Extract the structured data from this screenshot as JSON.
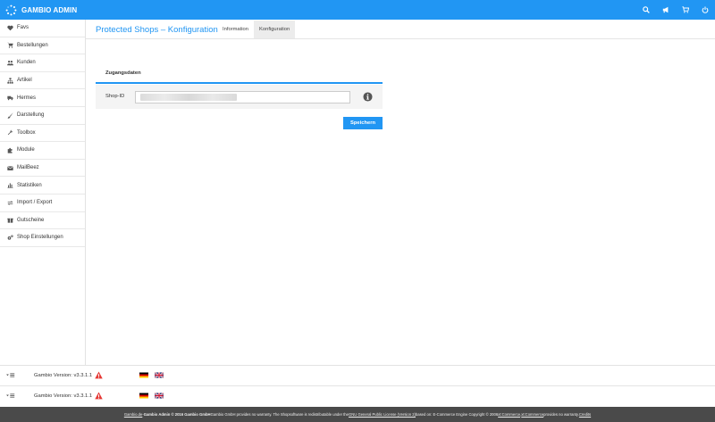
{
  "app": {
    "title": "GAMBIO ADMIN"
  },
  "topbar": {
    "icons": [
      "search-icon",
      "megaphone-icon",
      "cart-icon",
      "power-icon"
    ]
  },
  "sidebar": {
    "items": [
      {
        "label": "Favs",
        "icon": "heart-icon"
      },
      {
        "label": "Bestellungen",
        "icon": "cart-icon"
      },
      {
        "label": "Kunden",
        "icon": "users-icon"
      },
      {
        "label": "Artikel",
        "icon": "sitemap-icon"
      },
      {
        "label": "Hermes",
        "icon": "truck-icon"
      },
      {
        "label": "Darstellung",
        "icon": "brush-icon"
      },
      {
        "label": "Toolbox",
        "icon": "wrench-icon"
      },
      {
        "label": "Module",
        "icon": "puzzle-icon"
      },
      {
        "label": "MailBeez",
        "icon": "envelope-icon"
      },
      {
        "label": "Statistiken",
        "icon": "bar-chart-icon"
      },
      {
        "label": "Import / Export",
        "icon": "exchange-icon"
      },
      {
        "label": "Gutscheine",
        "icon": "gift-icon"
      },
      {
        "label": "Shop Einstellungen",
        "icon": "gears-icon"
      }
    ]
  },
  "page": {
    "title": "Protected Shops – Konfiguration",
    "tabs": [
      {
        "label": "Information",
        "active": false
      },
      {
        "label": "Konfiguration",
        "active": true
      }
    ]
  },
  "panel": {
    "heading": "Zugangsdaten",
    "field_label": "Shop-ID",
    "field_value": "",
    "save_label": "Speichern"
  },
  "footer_rows": [
    {
      "version": "Gambio Version: v3.3.1.1"
    },
    {
      "version": "Gambio Version: v3.3.1.1"
    }
  ],
  "bottombar": {
    "link1": "Gambio.de",
    "part1": " - ",
    "bold1": "Gambio Admin © 2016 Gambio GmbH",
    "part2": " Gambio GmbH provides no warranty. The Shopsoftware is redistributable under the ",
    "link2": "GNU General Public License (Version 2)",
    "part3": " based on: E-Commerce Engine Copyright © 2006 ",
    "link3": "xt:Commerce",
    "part4": ", ",
    "link4": "xt:Commerce",
    "part5": " provides no warranty. ",
    "link5": "Credits"
  },
  "colors": {
    "brand": "#2196f3",
    "footer": "#4a4a4a",
    "warning": "#e53935"
  }
}
